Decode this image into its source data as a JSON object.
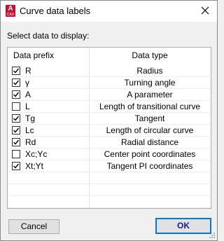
{
  "window": {
    "title": "Curve data labels",
    "app_icon_letter": "A",
    "app_icon_sub": "CAD"
  },
  "select_label": "Select data to display:",
  "table": {
    "headers": [
      "Data prefix",
      "Data type"
    ],
    "rows": [
      {
        "prefix": "R",
        "type": "Radius",
        "checked": true
      },
      {
        "prefix": "γ",
        "type": "Turning angle",
        "checked": true
      },
      {
        "prefix": "A",
        "type": "A parameter",
        "checked": true
      },
      {
        "prefix": "L",
        "type": "Length of transitional curve",
        "checked": false
      },
      {
        "prefix": "Tg",
        "type": "Tangent",
        "checked": true
      },
      {
        "prefix": "Lc",
        "type": "Length of circular curve",
        "checked": true
      },
      {
        "prefix": "Rd",
        "type": "Radial distance",
        "checked": true
      },
      {
        "prefix": "Xc;Yc",
        "type": "Center point coordinates",
        "checked": false
      },
      {
        "prefix": "Xt;Yt",
        "type": "Tangent PI coordinates",
        "checked": true
      }
    ]
  },
  "buttons": {
    "cancel": "Cancel",
    "ok": "OK"
  },
  "colors": {
    "accent": "#0078d7",
    "brand": "#c8102e"
  }
}
